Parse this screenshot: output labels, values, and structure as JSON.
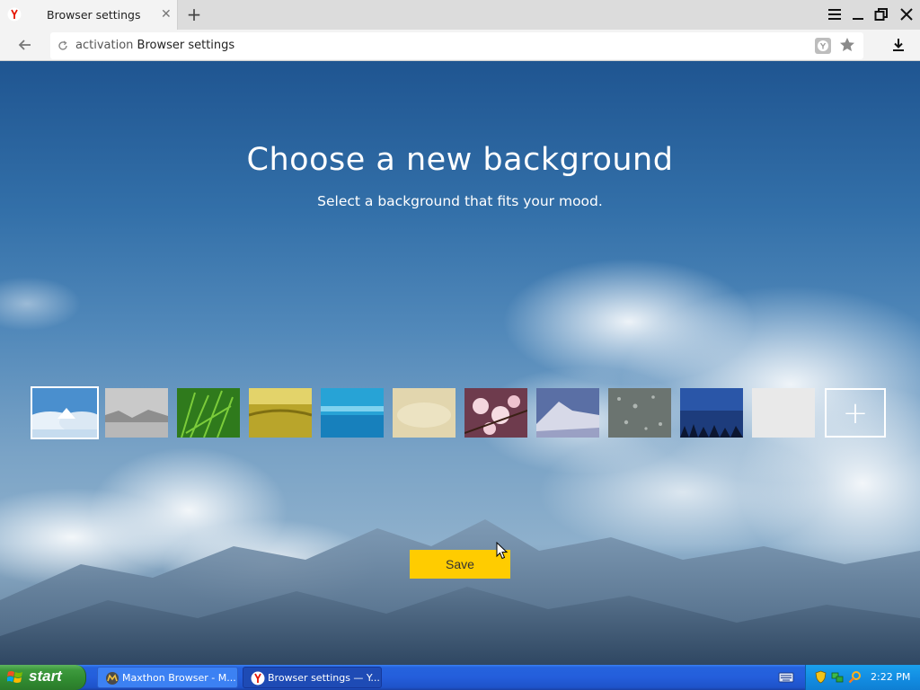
{
  "browser": {
    "tab": {
      "title": "Browser settings"
    },
    "new_tab_symbol": "+",
    "address": {
      "protocol": "activation",
      "page": "Browser settings"
    }
  },
  "content": {
    "heading": "Choose a new background",
    "subheading": "Select a background that fits your mood.",
    "thumbnails": [
      {
        "name": "clouds-snow",
        "selected": true
      },
      {
        "name": "fog-hills",
        "selected": false
      },
      {
        "name": "green-grass",
        "selected": false
      },
      {
        "name": "yellow-field",
        "selected": false
      },
      {
        "name": "blue-sea",
        "selected": false
      },
      {
        "name": "sand",
        "selected": false
      },
      {
        "name": "cherry-blossom",
        "selected": false
      },
      {
        "name": "mountain-peak",
        "selected": false
      },
      {
        "name": "raindrops",
        "selected": false
      },
      {
        "name": "night-forest",
        "selected": false
      },
      {
        "name": "plain-white",
        "selected": false
      }
    ],
    "add_symbol": "+",
    "save_label": "Save"
  },
  "taskbar": {
    "start_label": "start",
    "tasks": [
      {
        "label": "Maxthon Browser - M...",
        "active": false
      },
      {
        "label": "Browser settings — Y...",
        "active": true
      }
    ],
    "clock": "2:22 PM"
  },
  "colors": {
    "save_button": "#ffcc00",
    "taskbar_blue": "#245edb",
    "start_green": "#3d9a3d",
    "tray_blue": "#138ee3"
  }
}
